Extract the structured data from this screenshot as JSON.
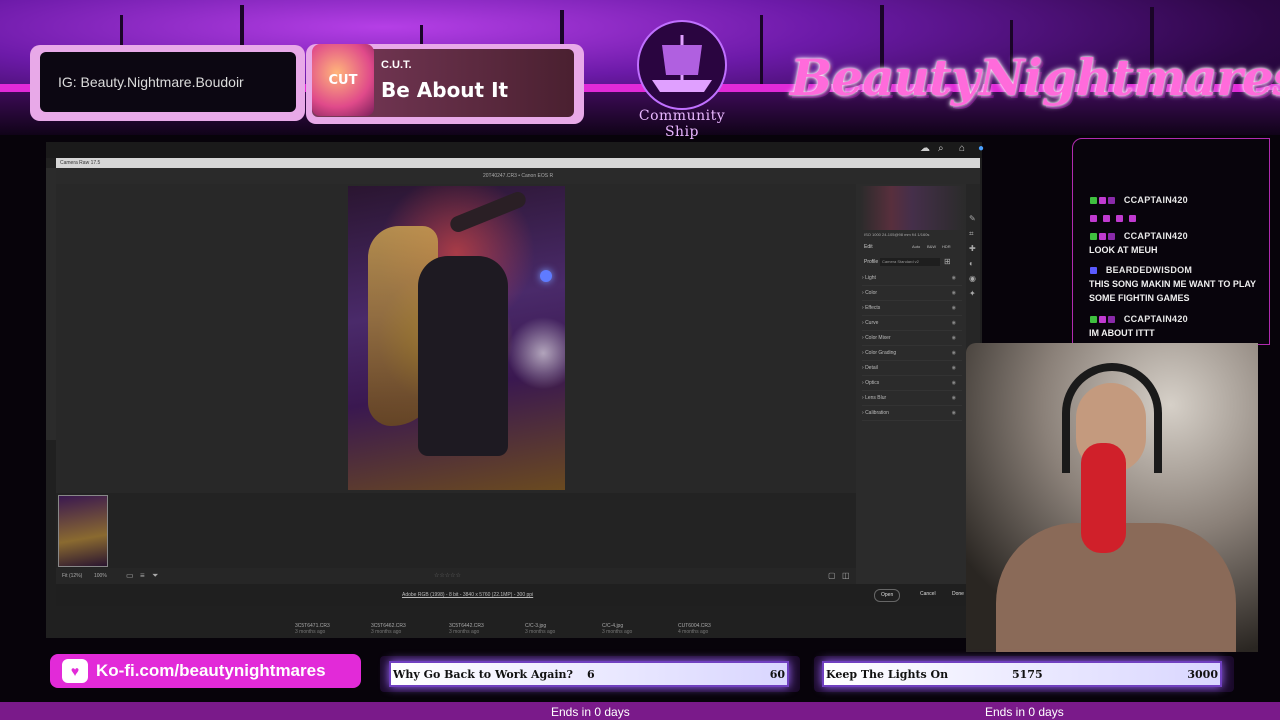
{
  "overlay": {
    "instagram": "IG: Beauty.Nightmare.Boudoir",
    "now_playing": {
      "artist": "C.U.T.",
      "title": "Be About It",
      "art_text": "CUT"
    },
    "logo_text": "Community Ship",
    "brand": "BeautyNightmares",
    "kofi": "Ko-fi.com/beautynightmares",
    "goals": [
      {
        "name": "Why Go Back to Work Again?",
        "current": "6",
        "target": "60",
        "ends": "Ends in 0 days"
      },
      {
        "name": "Keep The Lights On",
        "current": "5175",
        "target": "3000",
        "ends": "Ends in 0 days"
      }
    ]
  },
  "chat": [
    {
      "user": "CCAPTAIN420",
      "message": ""
    },
    {
      "user": "CCAPTAIN420",
      "message": "LOOK AT MEUH"
    },
    {
      "user": "BEARDEDWISDOM",
      "message": "THIS SONG MAKIN ME WANT TO PLAY SOME FIGHTIN GAMES"
    },
    {
      "user": "CCAPTAIN420",
      "message": "IM ABOUT ITTT"
    }
  ],
  "camera_raw": {
    "window_title": "Camera Raw 17.5",
    "file_info": "20T40247.CR3 • Canon EOS R",
    "camera_info": "ISO 1000   24-105@98 mm   f/4   1/160s",
    "edit_label": "Edit",
    "auto_label": "Auto",
    "bw_label": "B&W",
    "hdr_label": "HDR",
    "profile_label": "Profile",
    "profile_value": "Camera Standard v2",
    "panels": [
      "Light",
      "Color",
      "Effects",
      "Curve",
      "Color Mixer",
      "Color Grading",
      "Detail",
      "Optics",
      "Lens Blur",
      "Calibration"
    ],
    "zoom_fit": "Fit (12%)",
    "zoom_value": "100%",
    "footer_info": "Adobe RGB (1998) - 8 bit - 3840 x 5760 (22.1MP) - 300 ppi",
    "open_btn": "Open",
    "cancel_btn": "Cancel",
    "done_btn": "Done"
  },
  "browser_files": [
    {
      "name": "3C5T6471.CR3",
      "time": "3 months ago"
    },
    {
      "name": "3C5T6462.CR3",
      "time": "3 months ago"
    },
    {
      "name": "3C5T6442.CR3",
      "time": "3 months ago"
    },
    {
      "name": "C/C-3.jpg",
      "time": "3 months ago"
    },
    {
      "name": "C/C-4.jpg",
      "time": "3 months ago"
    },
    {
      "name": "CUT6004.CR3",
      "time": "4 months ago"
    }
  ]
}
